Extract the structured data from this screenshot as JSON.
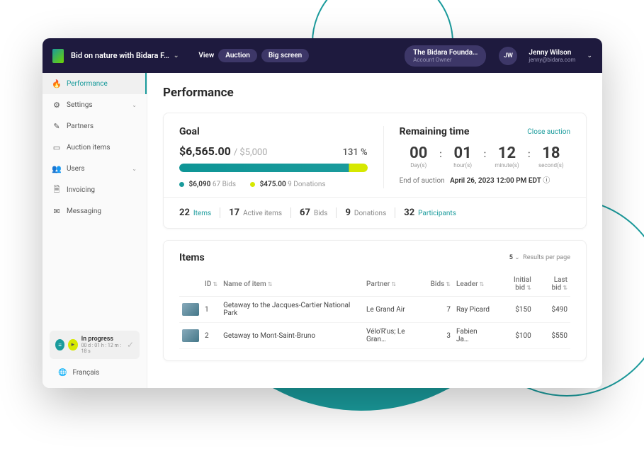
{
  "header": {
    "auction_name": "Bid on nature with Bidara F…",
    "view_label": "View",
    "btn_auction": "Auction",
    "btn_bigscreen": "Big screen",
    "org_name": "The Bidara Founda…",
    "org_role": "Account Owner",
    "avatar_initials": "JW",
    "user_name": "Jenny Wilson",
    "user_email": "jenny@bidara.com"
  },
  "sidebar": {
    "items": [
      {
        "label": "Performance",
        "icon": "🔥",
        "active": true,
        "expandable": false
      },
      {
        "label": "Settings",
        "icon": "⚙",
        "active": false,
        "expandable": true
      },
      {
        "label": "Partners",
        "icon": "✎",
        "active": false,
        "expandable": false
      },
      {
        "label": "Auction items",
        "icon": "▭",
        "active": false,
        "expandable": false
      },
      {
        "label": "Users",
        "icon": "👥",
        "active": false,
        "expandable": true
      },
      {
        "label": "Invoicing",
        "icon": "🗎",
        "active": false,
        "expandable": false
      },
      {
        "label": "Messaging",
        "icon": "✉",
        "active": false,
        "expandable": false
      }
    ],
    "status_label": "In progress",
    "status_time": "00 d : 01 h : 12 m : 18 s",
    "lang": "Français"
  },
  "page": {
    "title": "Performance",
    "goal": {
      "title": "Goal",
      "current": "$6,565.00",
      "target": "/ $5,000",
      "percent": "131 %",
      "bids_amount": "$6,090",
      "bids_count": "67 Bids",
      "donations_amount": "$475.00",
      "donations_count": "9 Donations"
    },
    "remaining": {
      "title": "Remaining time",
      "close": "Close auction",
      "days": "00",
      "days_lbl": "Day(s)",
      "hours": "01",
      "hours_lbl": "hour(s)",
      "minutes": "12",
      "minutes_lbl": "minute(s)",
      "seconds": "18",
      "seconds_lbl": "second(s)",
      "end_label": "End of auction",
      "end_date": "April 26, 2023 12:00 PM EDT"
    },
    "stats": [
      {
        "num": "22",
        "lbl": "Items",
        "teal": true
      },
      {
        "num": "17",
        "lbl": "Active items",
        "teal": false
      },
      {
        "num": "67",
        "lbl": "Bids",
        "teal": false
      },
      {
        "num": "9",
        "lbl": "Donations",
        "teal": false
      },
      {
        "num": "32",
        "lbl": "Participants",
        "teal": true
      }
    ],
    "items": {
      "title": "Items",
      "rpp_num": "5",
      "rpp_label": "Results per page",
      "columns": [
        "ID",
        "Name of item",
        "Partner",
        "Bids",
        "Leader",
        "Initial bid",
        "Last bid"
      ],
      "rows": [
        {
          "id": "1",
          "name": "Getaway to the Jacques-Cartier National Park",
          "partner": "Le Grand Air",
          "bids": "7",
          "leader": "Ray Picard",
          "initial": "$150",
          "last": "$490"
        },
        {
          "id": "2",
          "name": "Getaway to Mont-Saint-Bruno",
          "partner": "Vélo'R'us; Le Gran…",
          "bids": "3",
          "leader": "Fabien Ja…",
          "initial": "$100",
          "last": "$550"
        }
      ]
    }
  }
}
